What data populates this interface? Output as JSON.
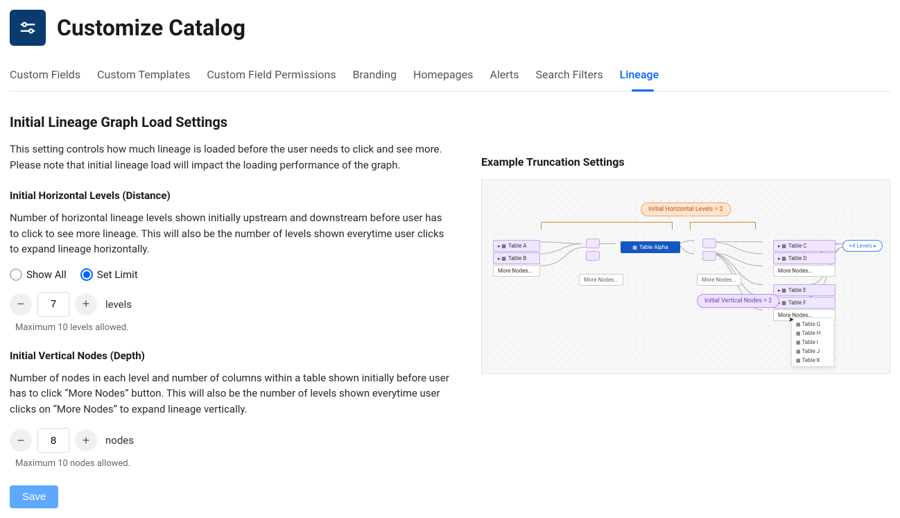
{
  "page_title": "Customize Catalog",
  "tabs": {
    "custom_fields": "Custom Fields",
    "custom_templates": "Custom Templates",
    "custom_field_permissions": "Custom Field Permissions",
    "branding": "Branding",
    "homepages": "Homepages",
    "alerts": "Alerts",
    "search_filters": "Search Filters",
    "lineage": "Lineage"
  },
  "section": {
    "title": "Initial Lineage Graph Load Settings",
    "desc": "This setting controls how much lineage is loaded before the user needs to click and see more. Please note that initial lineage load will impact the loading performance of the graph."
  },
  "horizontal": {
    "title": "Initial Horizontal Levels (Distance)",
    "desc": "Number of horizontal lineage levels shown initially upstream and downstream before user has to click to see more lineage. This will also be the number of levels shown everytime user clicks to expand lineage horizontally.",
    "radio_show_all": "Show All",
    "radio_set_limit": "Set Limit",
    "value": "7",
    "unit": "levels",
    "hint": "Maximum 10 levels allowed."
  },
  "vertical": {
    "title": "Initial Vertical Nodes (Depth)",
    "desc": "Number of nodes in each level and number of columns within a table shown initially before user has to click “More Nodes” button. This will also be the number of levels shown everytime user clicks on “More Nodes” to expand lineage vertically.",
    "value": "8",
    "unit": "nodes",
    "hint": "Maximum 10 nodes allowed."
  },
  "save_label": "Save",
  "example": {
    "title": "Example Truncation Settings",
    "badge_horiz": "Initial Horizontal Levels = 2",
    "badge_vert": "Initial Vertical Nodes = 2",
    "levels_btn": "+4 Levels",
    "more": "More Nodes...",
    "center": "Table Alpha",
    "left": {
      "a": "Table A",
      "b": "Table B"
    },
    "right": {
      "c": "Table C",
      "d": "Table D",
      "e": "Table E",
      "f": "Table F"
    },
    "dropdown": {
      "g": "Table G",
      "h": "Table H",
      "i": "Table I",
      "j": "Table J",
      "k": "Table K"
    }
  }
}
